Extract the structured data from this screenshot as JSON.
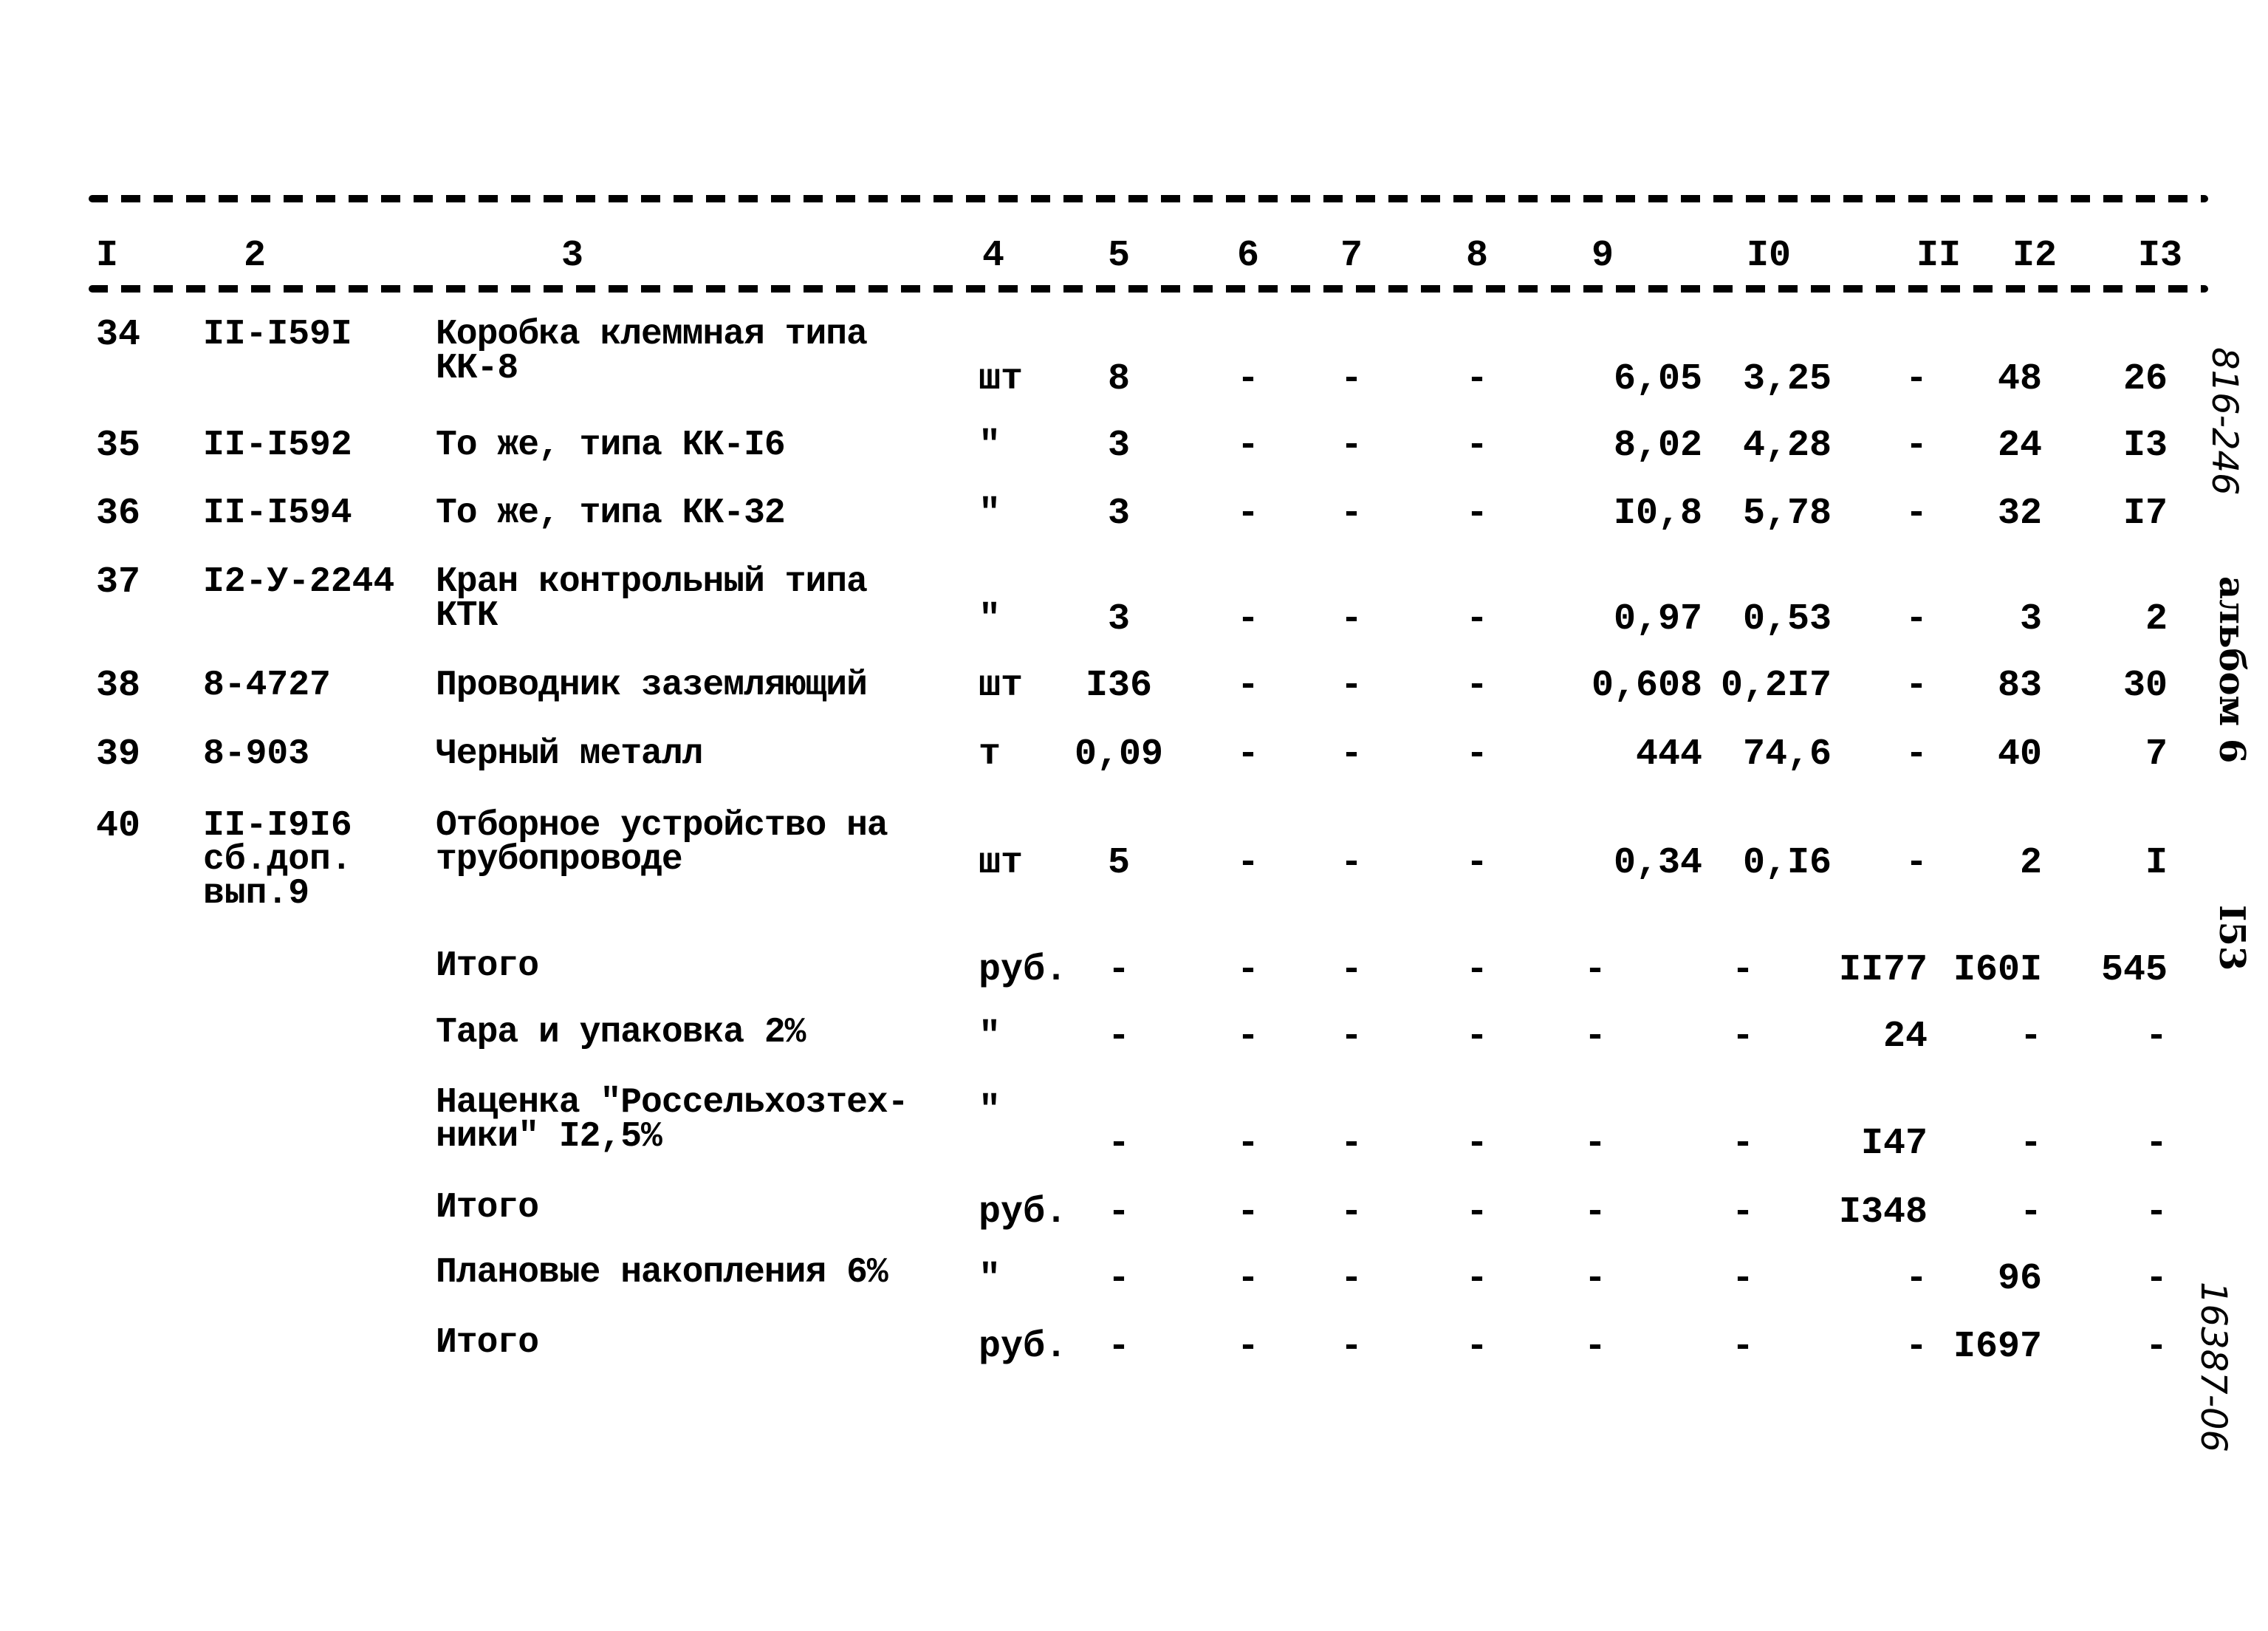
{
  "table": {
    "column_headers": [
      "I",
      "2",
      "3",
      "4",
      "5",
      "6",
      "7",
      "8",
      "9",
      "I0",
      "II",
      "I2",
      "I3"
    ],
    "rows": [
      {
        "n": "34",
        "code": "II-I59I",
        "desc": "Коробка клеммная типа\nКК-8",
        "unit": "шт",
        "c5": "8",
        "c6": "-",
        "c7": "-",
        "c8": "-",
        "c9": "6,05",
        "c10": "3,25",
        "c11": "-",
        "c12": "48",
        "c13": "26"
      },
      {
        "n": "35",
        "code": "II-I592",
        "desc": "То же, типа КК-I6",
        "unit": "\"",
        "c5": "3",
        "c6": "-",
        "c7": "-",
        "c8": "-",
        "c9": "8,02",
        "c10": "4,28",
        "c11": "-",
        "c12": "24",
        "c13": "I3"
      },
      {
        "n": "36",
        "code": "II-I594",
        "desc": "То же, типа КК-32",
        "unit": "\"",
        "c5": "3",
        "c6": "-",
        "c7": "-",
        "c8": "-",
        "c9": "I0,8",
        "c10": "5,78",
        "c11": "-",
        "c12": "32",
        "c13": "I7"
      },
      {
        "n": "37",
        "code": "I2-У-2244",
        "desc": "Кран контрольный типа\nКТК",
        "unit": "\"",
        "c5": "3",
        "c6": "-",
        "c7": "-",
        "c8": "-",
        "c9": "0,97",
        "c10": "0,53",
        "c11": "-",
        "c12": "3",
        "c13": "2"
      },
      {
        "n": "38",
        "code": "8-4727",
        "desc": "Проводник заземляющий",
        "unit": "шт",
        "c5": "I36",
        "c6": "-",
        "c7": "-",
        "c8": "-",
        "c9": "0,608",
        "c10": "0,2I7",
        "c11": "-",
        "c12": "83",
        "c13": "30"
      },
      {
        "n": "39",
        "code": "8-903",
        "desc": "Черный металл",
        "unit": "т",
        "c5": "0,09",
        "c6": "-",
        "c7": "-",
        "c8": "-",
        "c9": "444",
        "c10": "74,6",
        "c11": "-",
        "c12": "40",
        "c13": "7"
      },
      {
        "n": "40",
        "code": "II-I9I6\nсб.доп.\nвып.9",
        "desc": "Отборное устройство на\nтрубопроводе",
        "unit": "шт",
        "c5": "5",
        "c6": "-",
        "c7": "-",
        "c8": "-",
        "c9": "0,34",
        "c10": "0,I6",
        "c11": "-",
        "c12": "2",
        "c13": "I"
      }
    ],
    "summary": [
      {
        "desc": "Итого",
        "unit": "руб.",
        "c5": "-",
        "c6": "-",
        "c7": "-",
        "c8": "-",
        "c9": "-",
        "c10": "-",
        "c11": "II77",
        "c12": "I60I",
        "c13": "545"
      },
      {
        "desc": "Тара и упаковка 2%",
        "unit": "\"",
        "c5": "-",
        "c6": "-",
        "c7": "-",
        "c8": "-",
        "c9": "-",
        "c10": "-",
        "c11": "24",
        "c12": "-",
        "c13": "-"
      },
      {
        "desc": "Наценка \"Россельхозтех-\nники\" I2,5%",
        "unit": "\"",
        "c5": "-",
        "c6": "-",
        "c7": "-",
        "c8": "-",
        "c9": "-",
        "c10": "-",
        "c11": "I47",
        "c12": "-",
        "c13": "-"
      },
      {
        "desc": "Итого",
        "unit": "руб.",
        "c5": "-",
        "c6": "-",
        "c7": "-",
        "c8": "-",
        "c9": "-",
        "c10": "-",
        "c11": "I348",
        "c12": "-",
        "c13": "-"
      },
      {
        "desc": "Плановые накопления 6%",
        "unit": "\"",
        "c5": "-",
        "c6": "-",
        "c7": "-",
        "c8": "-",
        "c9": "-",
        "c10": "-",
        "c11": "-",
        "c12": "96",
        "c13": "-"
      },
      {
        "desc": "Итого",
        "unit": "руб.",
        "c5": "-",
        "c6": "-",
        "c7": "-",
        "c8": "-",
        "c9": "-",
        "c10": "-",
        "c11": "-",
        "c12": "I697",
        "c13": "-"
      }
    ]
  },
  "margin": {
    "handwritten_top": "816-246",
    "album": "альбом 6",
    "page_number": "I53",
    "handwritten_bottom": "16387-06"
  }
}
